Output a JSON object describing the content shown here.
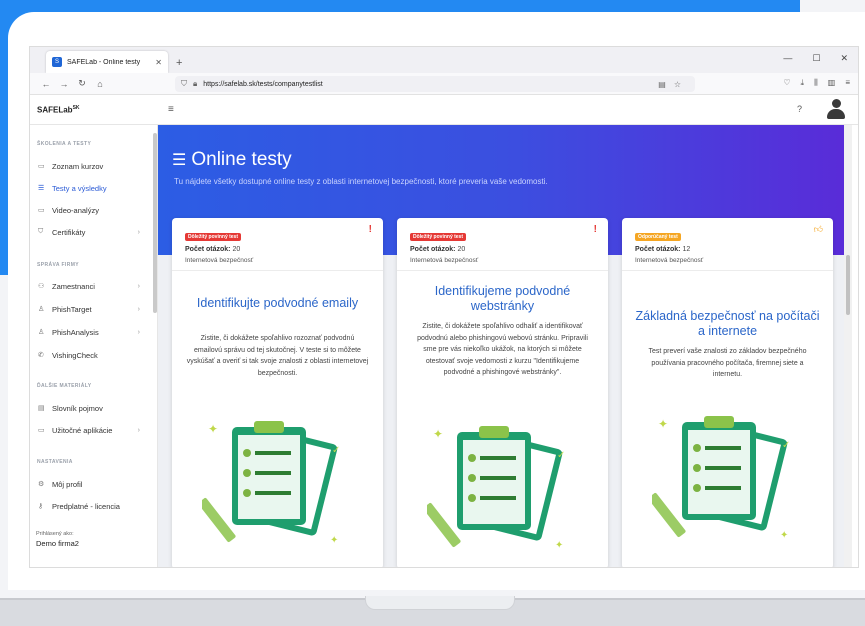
{
  "browser": {
    "tab_title": "SAFELab - Online testy",
    "tab_favicon": "S",
    "new_tab": "+",
    "url": "https://safelab.sk/tests/companytestlist"
  },
  "app": {
    "brand": "SAFELab",
    "brand_sup": "SK",
    "help": "?"
  },
  "sidebar": {
    "sections": {
      "training": "ŠKOLENIA A TESTY",
      "company": "SPRÁVA FIRMY",
      "materials": "ĎALŠIE MATERIÁLY",
      "settings": "NASTAVENIA"
    },
    "items": [
      {
        "label": "Zoznam kurzov",
        "icon": "book-icon"
      },
      {
        "label": "Testy a výsledky",
        "icon": "list-icon",
        "active": true
      },
      {
        "label": "Video-analýzy",
        "icon": "video-icon"
      },
      {
        "label": "Certifikáty",
        "icon": "certificate-icon",
        "chevron": true
      },
      {
        "label": "Zamestnanci",
        "icon": "users-icon",
        "chevron": true
      },
      {
        "label": "PhishTarget",
        "icon": "target-icon",
        "chevron": true
      },
      {
        "label": "PhishAnalysis",
        "icon": "analysis-icon",
        "chevron": true
      },
      {
        "label": "VishingCheck",
        "icon": "phone-icon"
      },
      {
        "label": "Slovník pojmov",
        "icon": "dictionary-icon"
      },
      {
        "label": "Užitočné aplikácie",
        "icon": "apps-icon",
        "chevron": true
      },
      {
        "label": "Môj profil",
        "icon": "profile-icon"
      },
      {
        "label": "Predplatné - licencia",
        "icon": "key-icon"
      }
    ],
    "logged_label": "Prihlásený ako:",
    "logged_user": "Demo firma2"
  },
  "hero": {
    "title": "Online testy",
    "subtitle": "Tu nájdete všetky dostupné online testy z oblasti internetovej bezpečnosti, ktoré preveria vaše vedomosti."
  },
  "cards": [
    {
      "badge": "Dôležitý povinný test",
      "count_label": "Počet otázok:",
      "count": "20",
      "category": "Internetová bezpečnosť",
      "title": "Identifikujte podvodné emaily",
      "description": "Zistite, či dokážete spoľahlivo rozoznať podvodnú emailovú správu od tej skutočnej. V teste si to môžete vyskúšať a overiť si tak svoje znalosti z oblasti internetovej bezpečnosti."
    },
    {
      "badge": "Dôležitý povinný test",
      "count_label": "Počet otázok:",
      "count": "20",
      "category": "Internetová bezpečnosť",
      "title": "Identifikujeme podvodné webstránky",
      "description": "Zistite, či dokážete spoľahlivo odhaliť a identifikovať podvodnú alebo phishingovú webovú stránku. Pripravili sme pre vás niekoľko ukážok, na ktorých si môžete otestovať svoje vedomosti z kurzu \"Identifikujeme podvodné a phishingové webstránky\"."
    },
    {
      "badge": "Odporúčaný test",
      "count_label": "Počet otázok:",
      "count": "12",
      "category": "Internetová bezpečnosť",
      "title": "Základná bezpečnosť na počítači a internete",
      "description": "Test preverí vaše znalosti zo základov bezpečného používania pracovného počítača, firemnej siete a internetu."
    }
  ]
}
